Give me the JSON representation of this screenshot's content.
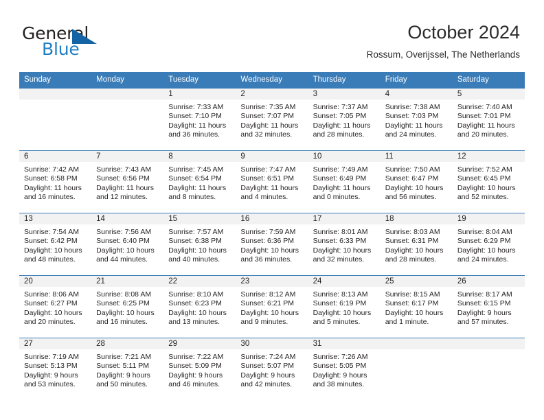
{
  "brand": {
    "word_one": "General",
    "word_two": "Blue",
    "triangle_icon": "triangle-logo-icon",
    "accent_color": "#1464a5",
    "blue_text_color": "#1f7fc4"
  },
  "header": {
    "title": "October 2024",
    "subtitle": "Rossum, Overijssel, The Netherlands"
  },
  "colors": {
    "header_row_bg": "#3a7cb8",
    "header_row_text": "#ffffff",
    "daynum_band_bg": "#f2f2f2",
    "row_divider": "#3a7cb8",
    "body_text": "#231f20"
  },
  "weekday_headers": [
    "Sunday",
    "Monday",
    "Tuesday",
    "Wednesday",
    "Thursday",
    "Friday",
    "Saturday"
  ],
  "labels": {
    "sunrise_prefix": "Sunrise:",
    "sunset_prefix": "Sunset:",
    "daylight_prefix": "Daylight:"
  },
  "weeks": [
    [
      {
        "day": "",
        "empty": true
      },
      {
        "day": "",
        "empty": true
      },
      {
        "day": "1",
        "sunrise": "Sunrise: 7:33 AM",
        "sunset": "Sunset: 7:10 PM",
        "daylight_line1": "Daylight: 11 hours",
        "daylight_line2": "and 36 minutes."
      },
      {
        "day": "2",
        "sunrise": "Sunrise: 7:35 AM",
        "sunset": "Sunset: 7:07 PM",
        "daylight_line1": "Daylight: 11 hours",
        "daylight_line2": "and 32 minutes."
      },
      {
        "day": "3",
        "sunrise": "Sunrise: 7:37 AM",
        "sunset": "Sunset: 7:05 PM",
        "daylight_line1": "Daylight: 11 hours",
        "daylight_line2": "and 28 minutes."
      },
      {
        "day": "4",
        "sunrise": "Sunrise: 7:38 AM",
        "sunset": "Sunset: 7:03 PM",
        "daylight_line1": "Daylight: 11 hours",
        "daylight_line2": "and 24 minutes."
      },
      {
        "day": "5",
        "sunrise": "Sunrise: 7:40 AM",
        "sunset": "Sunset: 7:01 PM",
        "daylight_line1": "Daylight: 11 hours",
        "daylight_line2": "and 20 minutes."
      }
    ],
    [
      {
        "day": "6",
        "sunrise": "Sunrise: 7:42 AM",
        "sunset": "Sunset: 6:58 PM",
        "daylight_line1": "Daylight: 11 hours",
        "daylight_line2": "and 16 minutes."
      },
      {
        "day": "7",
        "sunrise": "Sunrise: 7:43 AM",
        "sunset": "Sunset: 6:56 PM",
        "daylight_line1": "Daylight: 11 hours",
        "daylight_line2": "and 12 minutes."
      },
      {
        "day": "8",
        "sunrise": "Sunrise: 7:45 AM",
        "sunset": "Sunset: 6:54 PM",
        "daylight_line1": "Daylight: 11 hours",
        "daylight_line2": "and 8 minutes."
      },
      {
        "day": "9",
        "sunrise": "Sunrise: 7:47 AM",
        "sunset": "Sunset: 6:51 PM",
        "daylight_line1": "Daylight: 11 hours",
        "daylight_line2": "and 4 minutes."
      },
      {
        "day": "10",
        "sunrise": "Sunrise: 7:49 AM",
        "sunset": "Sunset: 6:49 PM",
        "daylight_line1": "Daylight: 11 hours",
        "daylight_line2": "and 0 minutes."
      },
      {
        "day": "11",
        "sunrise": "Sunrise: 7:50 AM",
        "sunset": "Sunset: 6:47 PM",
        "daylight_line1": "Daylight: 10 hours",
        "daylight_line2": "and 56 minutes."
      },
      {
        "day": "12",
        "sunrise": "Sunrise: 7:52 AM",
        "sunset": "Sunset: 6:45 PM",
        "daylight_line1": "Daylight: 10 hours",
        "daylight_line2": "and 52 minutes."
      }
    ],
    [
      {
        "day": "13",
        "sunrise": "Sunrise: 7:54 AM",
        "sunset": "Sunset: 6:42 PM",
        "daylight_line1": "Daylight: 10 hours",
        "daylight_line2": "and 48 minutes."
      },
      {
        "day": "14",
        "sunrise": "Sunrise: 7:56 AM",
        "sunset": "Sunset: 6:40 PM",
        "daylight_line1": "Daylight: 10 hours",
        "daylight_line2": "and 44 minutes."
      },
      {
        "day": "15",
        "sunrise": "Sunrise: 7:57 AM",
        "sunset": "Sunset: 6:38 PM",
        "daylight_line1": "Daylight: 10 hours",
        "daylight_line2": "and 40 minutes."
      },
      {
        "day": "16",
        "sunrise": "Sunrise: 7:59 AM",
        "sunset": "Sunset: 6:36 PM",
        "daylight_line1": "Daylight: 10 hours",
        "daylight_line2": "and 36 minutes."
      },
      {
        "day": "17",
        "sunrise": "Sunrise: 8:01 AM",
        "sunset": "Sunset: 6:33 PM",
        "daylight_line1": "Daylight: 10 hours",
        "daylight_line2": "and 32 minutes."
      },
      {
        "day": "18",
        "sunrise": "Sunrise: 8:03 AM",
        "sunset": "Sunset: 6:31 PM",
        "daylight_line1": "Daylight: 10 hours",
        "daylight_line2": "and 28 minutes."
      },
      {
        "day": "19",
        "sunrise": "Sunrise: 8:04 AM",
        "sunset": "Sunset: 6:29 PM",
        "daylight_line1": "Daylight: 10 hours",
        "daylight_line2": "and 24 minutes."
      }
    ],
    [
      {
        "day": "20",
        "sunrise": "Sunrise: 8:06 AM",
        "sunset": "Sunset: 6:27 PM",
        "daylight_line1": "Daylight: 10 hours",
        "daylight_line2": "and 20 minutes."
      },
      {
        "day": "21",
        "sunrise": "Sunrise: 8:08 AM",
        "sunset": "Sunset: 6:25 PM",
        "daylight_line1": "Daylight: 10 hours",
        "daylight_line2": "and 16 minutes."
      },
      {
        "day": "22",
        "sunrise": "Sunrise: 8:10 AM",
        "sunset": "Sunset: 6:23 PM",
        "daylight_line1": "Daylight: 10 hours",
        "daylight_line2": "and 13 minutes."
      },
      {
        "day": "23",
        "sunrise": "Sunrise: 8:12 AM",
        "sunset": "Sunset: 6:21 PM",
        "daylight_line1": "Daylight: 10 hours",
        "daylight_line2": "and 9 minutes."
      },
      {
        "day": "24",
        "sunrise": "Sunrise: 8:13 AM",
        "sunset": "Sunset: 6:19 PM",
        "daylight_line1": "Daylight: 10 hours",
        "daylight_line2": "and 5 minutes."
      },
      {
        "day": "25",
        "sunrise": "Sunrise: 8:15 AM",
        "sunset": "Sunset: 6:17 PM",
        "daylight_line1": "Daylight: 10 hours",
        "daylight_line2": "and 1 minute."
      },
      {
        "day": "26",
        "sunrise": "Sunrise: 8:17 AM",
        "sunset": "Sunset: 6:15 PM",
        "daylight_line1": "Daylight: 9 hours",
        "daylight_line2": "and 57 minutes."
      }
    ],
    [
      {
        "day": "27",
        "sunrise": "Sunrise: 7:19 AM",
        "sunset": "Sunset: 5:13 PM",
        "daylight_line1": "Daylight: 9 hours",
        "daylight_line2": "and 53 minutes."
      },
      {
        "day": "28",
        "sunrise": "Sunrise: 7:21 AM",
        "sunset": "Sunset: 5:11 PM",
        "daylight_line1": "Daylight: 9 hours",
        "daylight_line2": "and 50 minutes."
      },
      {
        "day": "29",
        "sunrise": "Sunrise: 7:22 AM",
        "sunset": "Sunset: 5:09 PM",
        "daylight_line1": "Daylight: 9 hours",
        "daylight_line2": "and 46 minutes."
      },
      {
        "day": "30",
        "sunrise": "Sunrise: 7:24 AM",
        "sunset": "Sunset: 5:07 PM",
        "daylight_line1": "Daylight: 9 hours",
        "daylight_line2": "and 42 minutes."
      },
      {
        "day": "31",
        "sunrise": "Sunrise: 7:26 AM",
        "sunset": "Sunset: 5:05 PM",
        "daylight_line1": "Daylight: 9 hours",
        "daylight_line2": "and 38 minutes."
      },
      {
        "day": "",
        "empty": true
      },
      {
        "day": "",
        "empty": true
      }
    ]
  ]
}
